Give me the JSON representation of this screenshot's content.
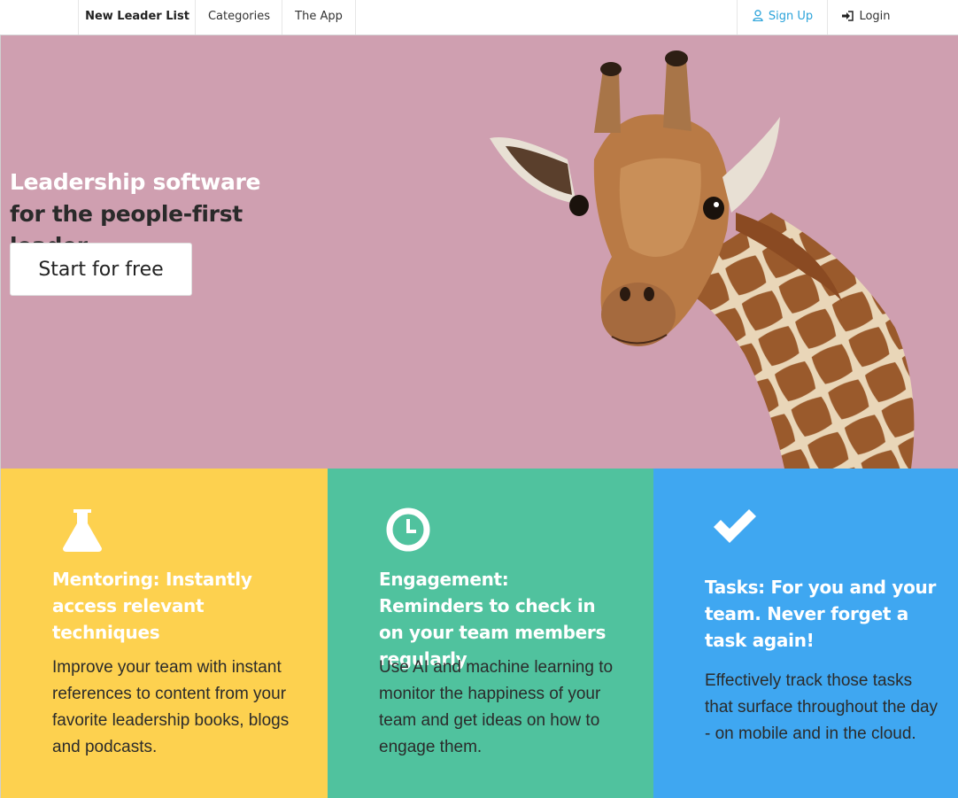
{
  "nav": {
    "brand": "New Leader List",
    "categories": "Categories",
    "app": "The App",
    "signup": "Sign Up",
    "login": "Login"
  },
  "hero": {
    "headline_highlight": "Leadership software",
    "headline_rest": " for the people-first leader",
    "cta": "Start for free",
    "background_color": "#cf9fb0",
    "image": "giraffe"
  },
  "features": [
    {
      "icon": "flask-icon",
      "color": "#fdd14f",
      "title": "Mentoring: Instantly access relevant techniques",
      "body": "Improve your team with instant references to content from your favorite leadership books, blogs and podcasts."
    },
    {
      "icon": "clock-icon",
      "color": "#50c29e",
      "title": "Engagement: Reminders to check in on your team members regularly",
      "body": "Use AI and machine learning to monitor the happiness of your team and get ideas on how to engage them."
    },
    {
      "icon": "checkmark-icon",
      "color": "#3fa7f1",
      "title": "Tasks: For you and your team. Never forget a task again!",
      "body": "Effectively track those tasks that surface throughout the day - on mobile and in the cloud."
    }
  ]
}
